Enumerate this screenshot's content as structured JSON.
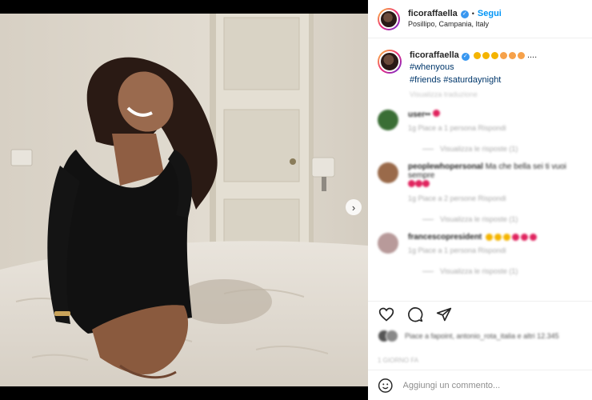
{
  "post": {
    "username": "ficoraffaella",
    "follow_label": "Segui",
    "location": "Posillipo, Campania, Italy",
    "caption_text": "....",
    "caption_hashtag_1": "#whenyous",
    "caption_hashtag_2": "#friends",
    "caption_hashtag_3": "#saturdaynight",
    "caption_meta": "Visualizza traduzione"
  },
  "comments": [
    {
      "user": "user••",
      "text": "",
      "meta": "1g   Piace a 1 persona   Rispondi",
      "replies": "Visualizza le risposte (1)",
      "avatar_color": "#3a6e35"
    },
    {
      "user": "peoplewhopersonal",
      "text": "Ma che bella sei ti vuoi sempre",
      "meta": "1g   Piace a 2 persone   Rispondi",
      "replies": "Visualizza le risposte (1)",
      "avatar_color": "#9a6a4a"
    },
    {
      "user": "francescopresident",
      "text": "",
      "meta": "1g   Piace a 1 persona   Rispondi",
      "replies": "Visualizza le risposte (1)",
      "avatar_color": "#b89a9a"
    }
  ],
  "likes_text": "Piace a fapoint, antonio_rota_italia e altri 12.345",
  "timestamp": "1 GIORNO FA",
  "comment_placeholder": "Aggiungi un commento...",
  "icons": {
    "like": "heart-icon",
    "comment": "comment-icon",
    "share": "paper-plane-icon",
    "emoji": "smiley-icon",
    "next": "chevron-right-icon",
    "verified": "verified-badge-icon"
  },
  "colors": {
    "accent": "#0095f6",
    "verified": "#3897f0",
    "hashtag": "#00376b"
  }
}
